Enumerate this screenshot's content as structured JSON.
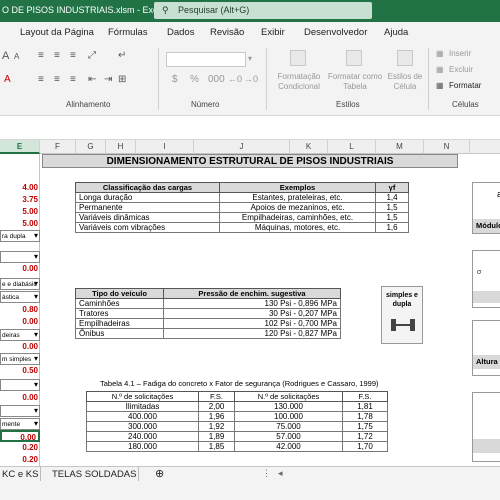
{
  "window": {
    "title": "O DE PISOS INDUSTRIAIS.xlsm  -  Excel",
    "search_placeholder": "Pesquisar (Alt+G)"
  },
  "menu": [
    "Layout da Página",
    "Fórmulas",
    "Dados",
    "Revisão",
    "Exibir",
    "Desenvolvedor",
    "Ajuda"
  ],
  "ribbon": {
    "groups": {
      "alinhamento": "Alinhamento",
      "numero": "Número",
      "estilos": "Estilos",
      "celulas": "Células"
    },
    "buttons": {
      "formatacao_condicional": "Formatação Condicional",
      "formatar_como_tabela": "Formatar como Tabela",
      "estilos_celula": "Estilos de Célula",
      "inserir": "Inserir",
      "excluir": "Excluir",
      "formatar": "Formatar"
    }
  },
  "columns": [
    "E",
    "F",
    "G",
    "H",
    "I",
    "J",
    "K",
    "L",
    "M",
    "N"
  ],
  "selected_column": "E",
  "left_cells": [
    "4.00",
    "3.75",
    "5.00",
    "5.00",
    "ra dupla",
    "",
    "0.00",
    "e e diabásic",
    "ástica",
    "0.80",
    "0.00",
    "deiras",
    "0.00",
    "m simples",
    "0.50",
    "",
    "0.00",
    "",
    "mente",
    "0.00",
    "",
    "0.20",
    "0.20"
  ],
  "banner": "DIMENSIONAMENTO ESTRUTURAL DE PISOS INDUSTRIAIS",
  "loads_table": {
    "headers": [
      "Classificação das cargas",
      "Exemplos",
      "γf"
    ],
    "rows": [
      [
        "Longa duração",
        "Estantes, prateleiras, etc.",
        "1,4"
      ],
      [
        "Permanente",
        "Apoios de mezaninos, etc.",
        "1,5"
      ],
      [
        "Variáveis dinâmicas",
        "Empilhadeiras, caminhões, etc.",
        "1,5"
      ],
      [
        "Variáveis com vibrações",
        "Máquinas, motores, etc.",
        "1,6"
      ]
    ]
  },
  "vehicle_table": {
    "headers": [
      "Tipo do veículo",
      "Pressão de enchim. sugestiva"
    ],
    "rows": [
      [
        "Caminhões",
        "130 Psi - 0,896 MPa"
      ],
      [
        "Tratores",
        "30 Psi - 0,207 MPa"
      ],
      [
        "Empilhadeiras",
        "102 Psi - 0,700 MPa"
      ],
      [
        "Ônibus",
        "120 Psi - 0,827 MPa"
      ]
    ]
  },
  "axle_label": "simples e dupla",
  "fatigue_caption": "Tabela 4.1 – Fadiga do concreto x Fator de segurança (Rodrigues e Cassaro, 1999)",
  "fatigue_table": {
    "headers": [
      "N.º de solicitações",
      "F.S.",
      "N.º de solicitações",
      "F.S."
    ],
    "rows": [
      [
        "Ilimitadas",
        "2,00",
        "130.000",
        "1,81"
      ],
      [
        "400.000",
        "1,96",
        "100.000",
        "1,78"
      ],
      [
        "300.000",
        "1,92",
        "75.000",
        "1,75"
      ],
      [
        "240.000",
        "1,89",
        "57.000",
        "1,72"
      ],
      [
        "180.000",
        "1,85",
        "42.000",
        "1,70"
      ]
    ]
  },
  "right_boxes": {
    "modulo": "Módulo",
    "altura": "Altura"
  },
  "sheet_tabs": [
    "KC e KS",
    "TELAS SOLDADAS"
  ],
  "colors": {
    "excel_green": "#217346",
    "red_value": "#c00000",
    "header_gray": "#d9d9d9"
  }
}
